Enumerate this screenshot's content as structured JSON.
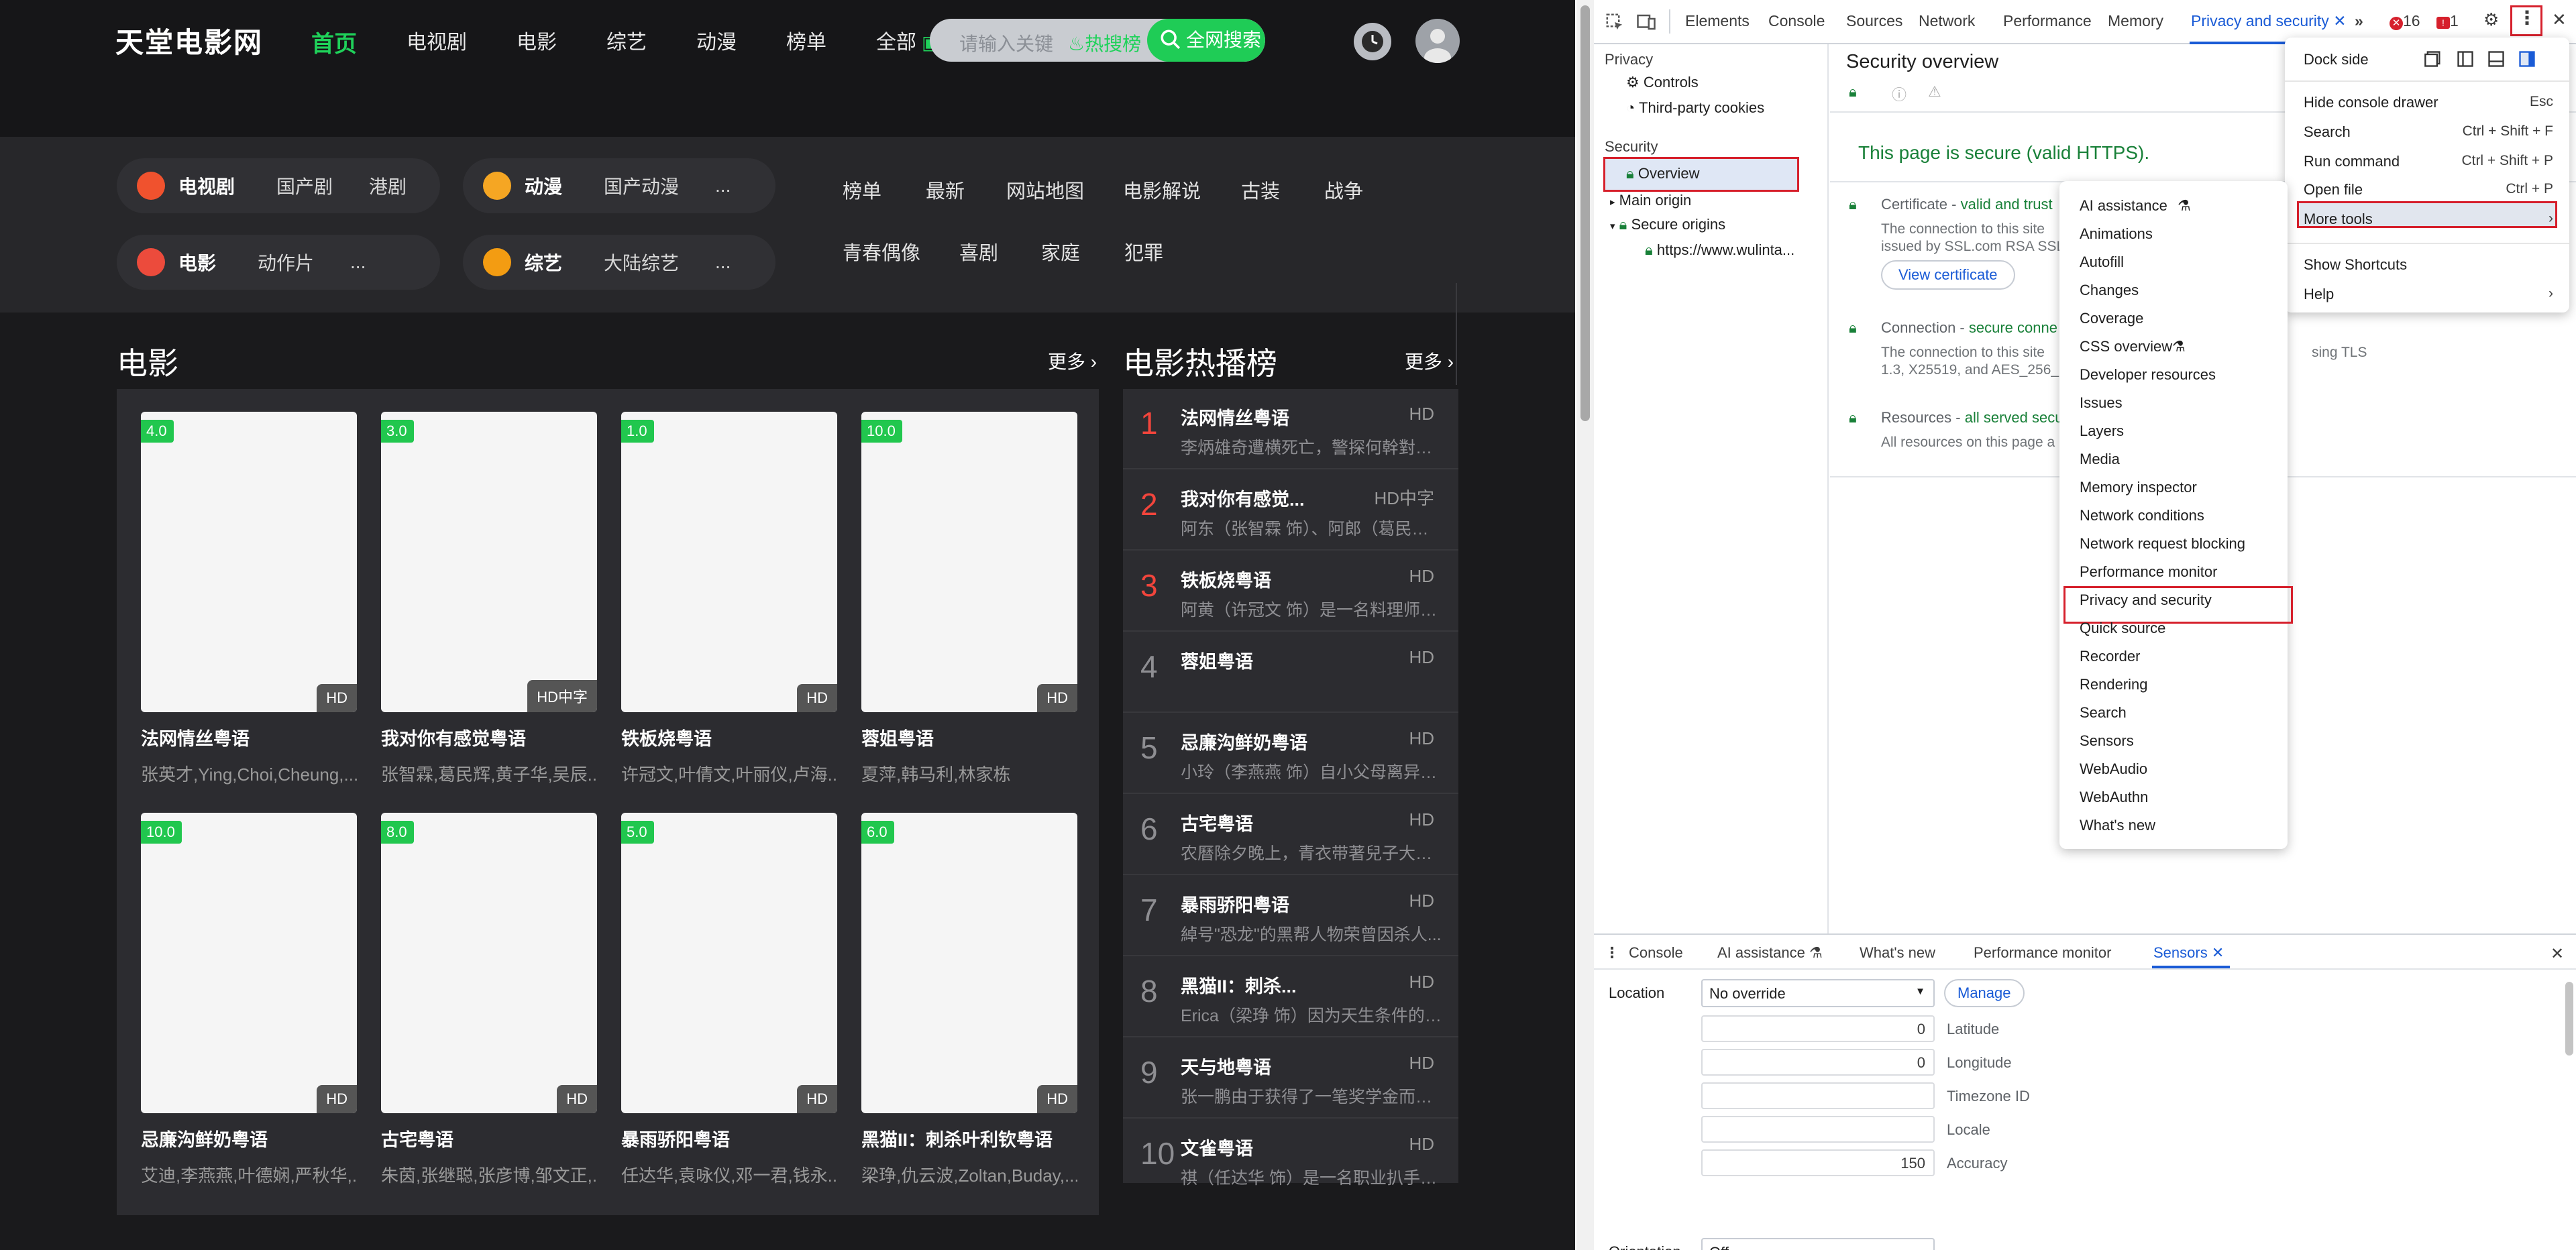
{
  "site": {
    "logo": "天堂电影网",
    "nav": [
      "首页",
      "电视剧",
      "电影",
      "综艺",
      "动漫",
      "榜单",
      "全部"
    ],
    "search": {
      "placeholder": "请输入关键",
      "hot": "热搜榜",
      "button": "全网搜索"
    },
    "pills": [
      {
        "title": "电视剧",
        "subs": [
          "国产剧",
          "港剧"
        ],
        "color": "#f0522e"
      },
      {
        "title": "动漫",
        "subs": [
          "国产动漫",
          "..."
        ],
        "color": "#f5a623"
      },
      {
        "title": "电影",
        "subs": [
          "动作片",
          "..."
        ],
        "color": "#ec4b3c"
      },
      {
        "title": "综艺",
        "subs": [
          "大陆综艺",
          "..."
        ],
        "color": "#f39c12"
      }
    ],
    "categories_row1": [
      "榜单",
      "最新",
      "网站地图",
      "电影解说",
      "古装",
      "战争"
    ],
    "categories_row2": [
      "青春偶像",
      "喜剧",
      "家庭",
      "犯罪"
    ],
    "movies_section": {
      "title": "电影",
      "more": "更多 ›"
    },
    "movies": [
      {
        "score": "4.0",
        "badge": "HD",
        "title": "法网情丝粤语",
        "cast": "张英才,Ying,Choi,Cheung,..."
      },
      {
        "score": "3.0",
        "badge": "HD中字",
        "title": "我对你有感觉粤语",
        "cast": "张智霖,葛民辉,黄子华,吴辰..."
      },
      {
        "score": "1.0",
        "badge": "HD",
        "title": "铁板烧粤语",
        "cast": "许冠文,叶倩文,叶丽仪,卢海..."
      },
      {
        "score": "10.0",
        "badge": "HD",
        "title": "蓉姐粤语",
        "cast": "夏萍,韩马利,林家栋"
      },
      {
        "score": "10.0",
        "badge": "HD",
        "title": "忌廉沟鲜奶粤语",
        "cast": "艾迪,李燕燕,叶德娴,严秋华,..."
      },
      {
        "score": "8.0",
        "badge": "HD",
        "title": "古宅粤语",
        "cast": "朱茵,张继聪,张彦博,邹文正,..."
      },
      {
        "score": "5.0",
        "badge": "HD",
        "title": "暴雨骄阳粤语",
        "cast": "任达华,袁咏仪,邓一君,钱永..."
      },
      {
        "score": "6.0",
        "badge": "HD",
        "title": "黑猫II：刺杀叶利钦粤语",
        "cast": "梁琤,仇云波,Zoltan,Buday,..."
      }
    ],
    "rank_section": {
      "title": "电影热播榜",
      "more": "更多 ›"
    },
    "rank": [
      {
        "n": "1",
        "title": "法网情丝粤语",
        "q": "HD",
        "desc": "李炳雄奇遭横死亡，警探何幹對於胡普..."
      },
      {
        "n": "2",
        "title": "我对你有感觉...",
        "q": "HD中字",
        "desc": "阿东（张智霖 饰）、阿郎（葛民辉 ..."
      },
      {
        "n": "3",
        "title": "铁板烧粤语",
        "q": "HD",
        "desc": "阿黄（许冠文 饰）是一名料理师，..."
      },
      {
        "n": "4",
        "title": "蓉姐粤语",
        "q": "HD",
        "desc": ""
      },
      {
        "n": "5",
        "title": "忌廉沟鲜奶粤语",
        "q": "HD",
        "desc": "小玲（李燕燕 饰）自小父母离异，..."
      },
      {
        "n": "6",
        "title": "古宅粤语",
        "q": "HD",
        "desc": "农曆除夕晚上，青衣带著兒子大娃..."
      },
      {
        "n": "7",
        "title": "暴雨骄阳粤语",
        "q": "HD",
        "desc": "綽号\"恐龙\"的黑帮人物荣曾因杀人..."
      },
      {
        "n": "8",
        "title": "黑猫II：刺杀...",
        "q": "HD",
        "desc": "Erica（梁琤 饰）因为天生条件的天..."
      },
      {
        "n": "9",
        "title": "天与地粤语",
        "q": "HD",
        "desc": "张一鹏由于获得了一笔奖学金而到..."
      },
      {
        "n": "10",
        "title": "文雀粤语",
        "q": "HD",
        "desc": "祺（任达华 饰）是一名职业扒手，..."
      }
    ]
  },
  "devtools": {
    "tabs": [
      "Elements",
      "Console",
      "Sources",
      "Network",
      "Performance",
      "Memory",
      "Privacy and security"
    ],
    "errors": "16",
    "warnings": "1",
    "sidebar": {
      "privacy": "Privacy",
      "controls": "Controls",
      "third_party": "Third-party cookies",
      "security": "Security",
      "overview": "Overview",
      "main_origin": "Main origin",
      "secure_origins": "Secure origins",
      "origin_url": "https://www.wulinta..."
    },
    "overview": {
      "title": "Security overview",
      "secure": "This page is secure (valid HTTPS).",
      "cert_label": "Certificate - ",
      "cert_value": "valid and trust",
      "cert_desc1": "The connection to this site",
      "cert_desc2": "issued by SSL.com RSA SSL",
      "view_cert": "View certificate",
      "conn_label": "Connection - ",
      "conn_value": "secure conne",
      "conn_desc1": "The connection to this site",
      "conn_desc1b": "sing TLS",
      "conn_desc2": "1.3, X25519, and AES_256_",
      "res_label": "Resources - ",
      "res_value": "all served secu",
      "res_desc": "All resources on this page a"
    },
    "drawer": {
      "tabs": [
        "Console",
        "AI assistance",
        "What's new",
        "Performance monitor",
        "Sensors"
      ],
      "location_label": "Location",
      "location_value": "No override",
      "manage": "Manage",
      "fields": [
        {
          "value": "0",
          "label": "Latitude"
        },
        {
          "value": "0",
          "label": "Longitude"
        },
        {
          "value": "",
          "label": "Timezone ID"
        },
        {
          "value": "",
          "label": "Locale"
        },
        {
          "value": "150",
          "label": "Accuracy"
        }
      ],
      "orientation_label": "Orientation",
      "orientation_value": "Off"
    },
    "main_menu": {
      "dock_side": "Dock side",
      "items": [
        {
          "label": "Hide console drawer",
          "key": "Esc"
        },
        {
          "label": "Search",
          "key": "Ctrl + Shift + F"
        },
        {
          "label": "Run command",
          "key": "Ctrl + Shift + P"
        },
        {
          "label": "Open file",
          "key": "Ctrl + P"
        },
        {
          "label": "More tools",
          "key": "›"
        },
        {
          "label": "Show Shortcuts",
          "key": ""
        },
        {
          "label": "Help",
          "key": "›"
        }
      ]
    },
    "more_tools": [
      "AI assistance",
      "Animations",
      "Autofill",
      "Changes",
      "Coverage",
      "CSS overview",
      "Developer resources",
      "Issues",
      "Layers",
      "Media",
      "Memory inspector",
      "Network conditions",
      "Network request blocking",
      "Performance monitor",
      "Privacy and security",
      "Quick source",
      "Recorder",
      "Rendering",
      "Search",
      "Sensors",
      "WebAudio",
      "WebAuthn",
      "What's new"
    ],
    "colors": {
      "accent": "#1a5bd6",
      "highlight": "#d6202c",
      "secure": "#188038"
    }
  }
}
